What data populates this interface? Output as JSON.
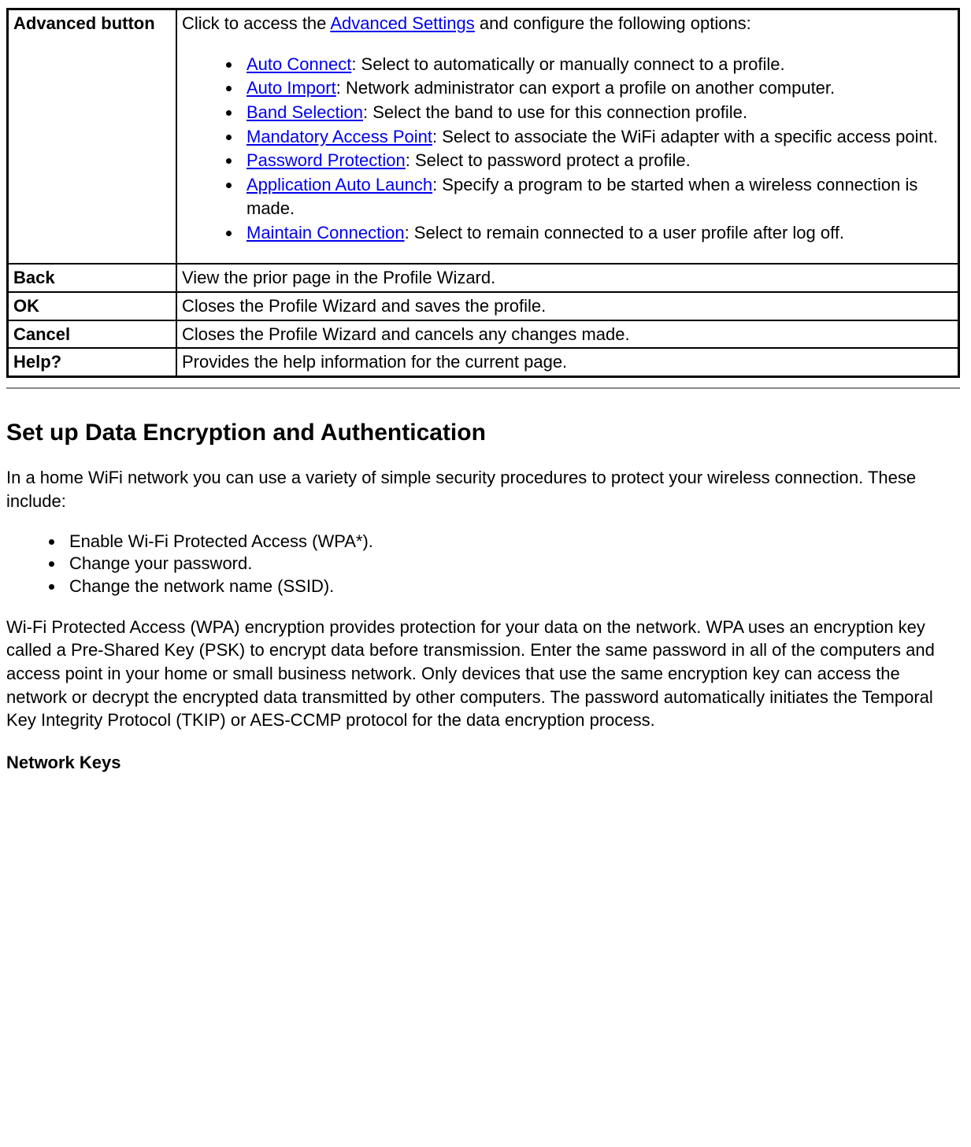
{
  "table": {
    "rows": [
      {
        "label": "Advanced button",
        "intro_before_link": "Click to access the ",
        "intro_link": "Advanced Settings",
        "intro_after_link": " and configure the following options:",
        "items": [
          {
            "link": "Auto Connect",
            "text": ": Select to automatically or manually connect to a profile."
          },
          {
            "link": "Auto Import",
            "text": ": Network administrator can export a profile on another computer."
          },
          {
            "link": "Band Selection",
            "text": ": Select the band to use for this connection profile."
          },
          {
            "link": "Mandatory Access Point",
            "text": ": Select to associate the WiFi adapter with a specific access point."
          },
          {
            "link": "Password Protection",
            "text": ": Select to password protect a profile."
          },
          {
            "link": "Application Auto Launch",
            "text": ": Specify a program to be started when a wireless connection is made."
          },
          {
            "link": "Maintain Connection",
            "text": ": Select to remain connected to a user profile after log off."
          }
        ]
      },
      {
        "label": "Back",
        "desc": "View the prior page in the Profile Wizard."
      },
      {
        "label": "OK",
        "desc": "Closes the Profile Wizard and saves the profile."
      },
      {
        "label": "Cancel",
        "desc": "Closes the Profile Wizard and cancels any changes made."
      },
      {
        "label": "Help?",
        "desc": "Provides the help information for the current page."
      }
    ]
  },
  "section": {
    "heading": "Set up Data Encryption and Authentication",
    "para1": "In a home WiFi network you can use a variety of simple security procedures to protect your wireless connection. These include:",
    "bullets": [
      "Enable Wi-Fi Protected Access (WPA*).",
      "Change your password.",
      "Change the network name (SSID)."
    ],
    "para2": "Wi-Fi Protected Access (WPA) encryption provides protection for your data on the network. WPA uses an encryption key called a Pre-Shared Key (PSK) to encrypt data before transmission. Enter the same password in all of the computers and access point in your home or small business network. Only devices that use the same encryption key can access the network or decrypt the encrypted data transmitted by other computers. The password automatically initiates the Temporal Key Integrity Protocol (TKIP) or AES-CCMP protocol for the data encryption process.",
    "subhead": "Network Keys"
  }
}
